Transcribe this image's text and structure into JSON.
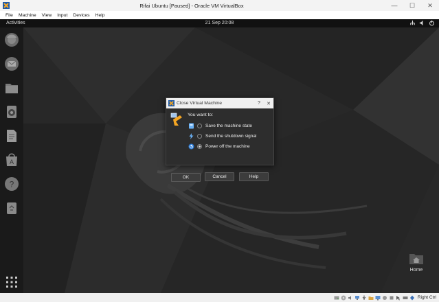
{
  "window": {
    "title": "Rifai Ubuntu [Paused] - Oracle VM VirtualBox",
    "controls": {
      "minimize": "—",
      "maximize": "☐",
      "close": "✕"
    }
  },
  "menu": [
    "File",
    "Machine",
    "View",
    "Input",
    "Devices",
    "Help"
  ],
  "guest": {
    "activities": "Activities",
    "clock": "21 Sep  20:08",
    "dock": [
      "firefox-icon",
      "thunderbird-icon",
      "files-icon",
      "rhythmbox-icon",
      "libreoffice-writer-icon",
      "ubuntu-software-icon",
      "help-icon",
      "trash-icon",
      "show-apps-icon"
    ],
    "desktop_home_label": "Home"
  },
  "dialog": {
    "title": "Close Virtual Machine",
    "help_btn": "?",
    "close_btn": "✕",
    "prompt": "You want to:",
    "options": [
      {
        "label": "Save the machine state",
        "selected": false
      },
      {
        "label": "Send the shutdown signal",
        "selected": false
      },
      {
        "label": "Power off the machine",
        "selected": true
      }
    ],
    "buttons": {
      "ok": "OK",
      "cancel": "Cancel",
      "help": "Help"
    }
  },
  "statusbar": {
    "host_key": "Right Ctrl"
  },
  "colors": {
    "guest_bg": "#262626",
    "dialog_bg": "#2d2d2d",
    "accent": "#2b7bd6"
  }
}
